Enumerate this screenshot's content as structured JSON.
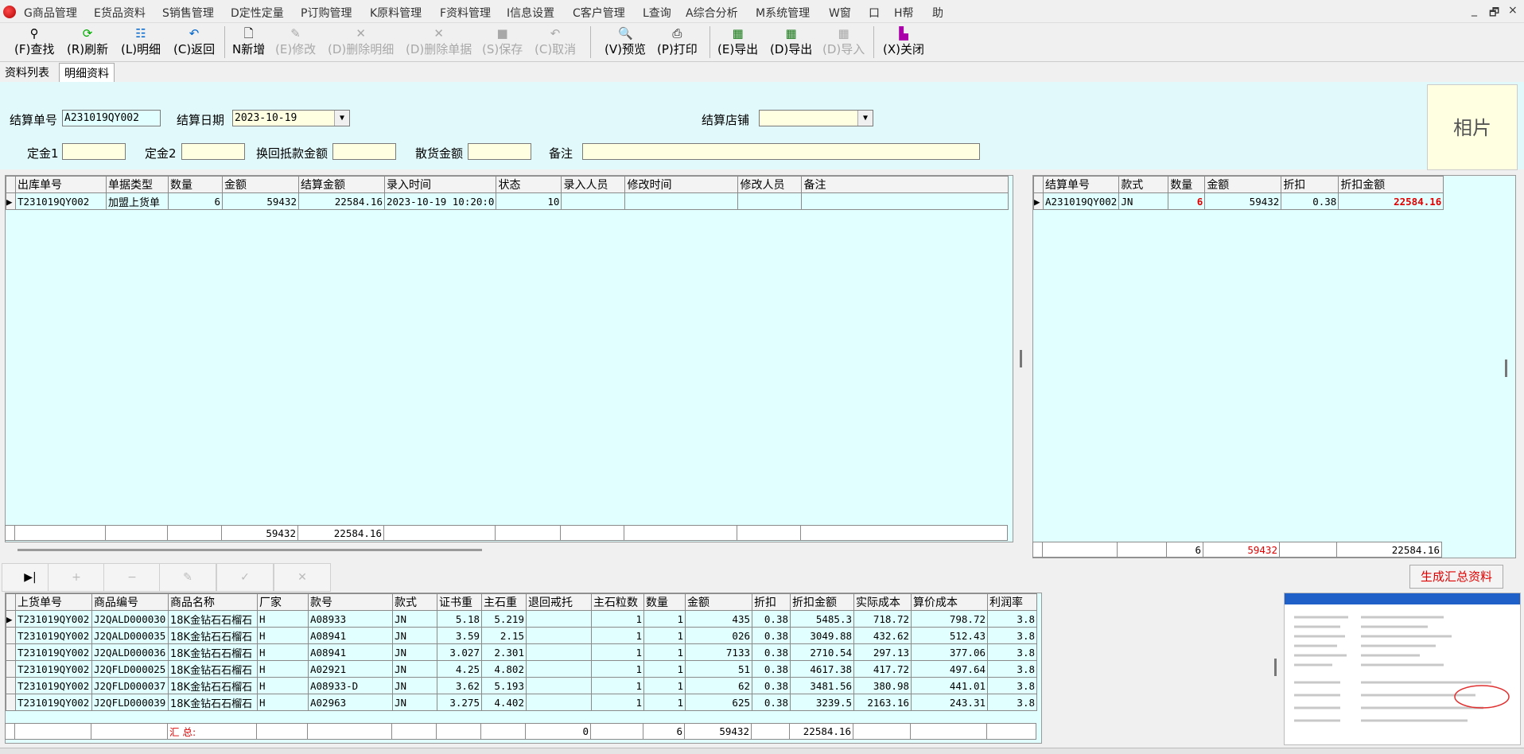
{
  "menu": [
    "G商品管理",
    "E货品资料",
    "S销售管理",
    "D定性定量",
    "P订购管理",
    "K原料管理",
    "F资料管理",
    "I信息设置",
    "C客户管理",
    "L查询",
    "A综合分析",
    "M系统管理",
    "W窗",
    "口",
    "H帮",
    "助"
  ],
  "window_controls": [
    "_",
    "🗗",
    "×"
  ],
  "toolbar": [
    {
      "label": "(F)查找",
      "icon": "binoculars-icon",
      "enabled": true
    },
    {
      "label": "(R)刷新",
      "icon": "refresh-icon",
      "enabled": true
    },
    {
      "label": "(L)明细",
      "icon": "detail-icon",
      "enabled": true
    },
    {
      "label": "(C)返回",
      "icon": "back-icon",
      "enabled": true
    },
    {
      "label": "N新增",
      "icon": "new-doc-icon",
      "enabled": true
    },
    {
      "label": "(E)修改",
      "icon": "edit-icon",
      "enabled": false
    },
    {
      "label": "(D)删除明细",
      "icon": "delete-icon",
      "enabled": false
    },
    {
      "label": "(D)删除单据",
      "icon": "delete-icon",
      "enabled": false
    },
    {
      "label": "(S)保存",
      "icon": "save-icon",
      "enabled": false
    },
    {
      "label": "(C)取消",
      "icon": "undo-icon",
      "enabled": false
    },
    {
      "label": "(V)预览",
      "icon": "preview-icon",
      "enabled": true
    },
    {
      "label": "(P)打印",
      "icon": "print-icon",
      "enabled": true
    },
    {
      "label": "(E)导出",
      "icon": "excel-icon",
      "enabled": true
    },
    {
      "label": "(D)导出",
      "icon": "excel-icon",
      "enabled": true
    },
    {
      "label": "(D)导入",
      "icon": "excel-icon",
      "enabled": false
    },
    {
      "label": "(X)关闭",
      "icon": "door-icon",
      "enabled": true
    }
  ],
  "tabs": [
    "资料列表",
    "明细资料"
  ],
  "form": {
    "settle_no_label": "结算单号",
    "settle_no": "A231019QY002",
    "settle_date_label": "结算日期",
    "settle_date": "2023-10-19",
    "store_label": "结算店铺",
    "store_value": "",
    "deposit1_label": "定金1",
    "deposit2_label": "定金2",
    "exchange_label": "换回抵款金额",
    "scatter_label": "散货金额",
    "remark_label": "备注",
    "photo_label": "相片"
  },
  "top_grid": {
    "headers": [
      "出库单号",
      "单据类型",
      "数量",
      "金额",
      "结算金额",
      "录入时间",
      "状态",
      "录入人员",
      "修改时间",
      "修改人员",
      "备注"
    ],
    "rows": [
      [
        "T231019QY002",
        "加盟上货单",
        "6",
        "59432",
        "22584.16",
        "2023-10-19 10:20:0",
        "10",
        "",
        "",
        "",
        ""
      ]
    ],
    "footer": [
      "",
      "",
      "",
      "59432",
      "22584.16",
      "",
      "",
      "",
      "",
      "",
      ""
    ]
  },
  "right_grid": {
    "headers": [
      "结算单号",
      "款式",
      "数量",
      "金额",
      "折扣",
      "折扣金额"
    ],
    "rows": [
      [
        "A231019QY002",
        "JN",
        "6",
        "59432",
        "0.38",
        "22584.16"
      ]
    ],
    "footer": [
      "",
      "",
      "6",
      "59432",
      "",
      "22584.16"
    ]
  },
  "gen_button": "生成汇总资料",
  "bottom_grid": {
    "headers": [
      "上货单号",
      "商品编号",
      "商品名称",
      "厂家",
      "款号",
      "款式",
      "证书重",
      "主石重",
      "退回戒托",
      "主石粒数",
      "数量",
      "金额",
      "折扣",
      "折扣金额",
      "实际成本",
      "算价成本",
      "利润率"
    ],
    "rows": [
      [
        "T231019QY002",
        "J2QALD000030",
        "18K金钻石石榴石",
        "H",
        "A08933",
        "JN",
        "5.18",
        "5.219",
        "",
        "1",
        "1",
        "435",
        "0.38",
        "5485.3",
        "718.72",
        "798.72",
        "3.8"
      ],
      [
        "T231019QY002",
        "J2QALD000035",
        "18K金钻石石榴石",
        "H",
        "A08941",
        "JN",
        "3.59",
        "2.15",
        "",
        "1",
        "1",
        "026",
        "0.38",
        "3049.88",
        "432.62",
        "512.43",
        "3.8"
      ],
      [
        "T231019QY002",
        "J2QALD000036",
        "18K金钻石石榴石",
        "H",
        "A08941",
        "JN",
        "3.027",
        "2.301",
        "",
        "1",
        "1",
        "7133",
        "0.38",
        "2710.54",
        "297.13",
        "377.06",
        "3.8"
      ],
      [
        "T231019QY002",
        "J2QFLD000025",
        "18K金钻石石榴石",
        "H",
        "A02921",
        "JN",
        "4.25",
        "4.802",
        "",
        "1",
        "1",
        "51",
        "0.38",
        "4617.38",
        "417.72",
        "497.64",
        "3.8"
      ],
      [
        "T231019QY002",
        "J2QFLD000037",
        "18K金钻石石榴石",
        "H",
        "A08933-D",
        "JN",
        "3.62",
        "5.193",
        "",
        "1",
        "1",
        "62",
        "0.38",
        "3481.56",
        "380.98",
        "441.01",
        "3.8"
      ],
      [
        "T231019QY002",
        "J2QFLD000039",
        "18K金钻石石榴石",
        "H",
        "A02963",
        "JN",
        "3.275",
        "4.402",
        "",
        "1",
        "1",
        "625",
        "0.38",
        "3239.5",
        "2163.16",
        "243.31",
        "3.8"
      ]
    ],
    "footer_label": "汇 总:",
    "footer": [
      "",
      "",
      "",
      "",
      "",
      "",
      "",
      "",
      "0",
      "",
      "6",
      "59432",
      "",
      "22584.16",
      "",
      "",
      ""
    ]
  }
}
